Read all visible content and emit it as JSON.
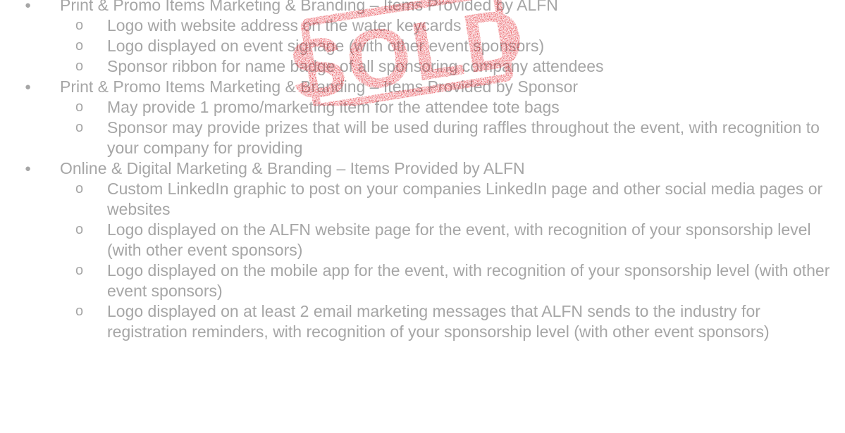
{
  "sections": [
    {
      "text": "Print & Promo Items Marketing & Branding – Items Provided by ALFN",
      "items": [
        "Logo with website address on the water keycards",
        "Logo displayed on event signage (with other event sponsors)",
        "Sponsor ribbon for name badge of all sponsoring company attendees"
      ]
    },
    {
      "text": "Print & Promo Items Marketing & Branding – Items Provided by Sponsor",
      "items": [
        "May provide 1 promo/marketing item for the attendee tote bags",
        "Sponsor may provide prizes that will be used during raffles throughout the event, with recognition to your company for providing"
      ]
    },
    {
      "text": "Online & Digital Marketing & Branding – Items Provided by ALFN",
      "items": [
        "Custom LinkedIn graphic to post on your companies LinkedIn page and other social media pages or websites",
        "Logo displayed on the ALFN website page for the event, with recognition of your sponsorship level (with other event sponsors)",
        "Logo displayed on the mobile app for the event, with recognition of your sponsorship level (with other event sponsors)",
        "Logo displayed on at least 2 email marketing messages that ALFN sends to the industry for registration reminders, with recognition of your sponsorship level (with other event sponsors)"
      ]
    }
  ],
  "stamp": {
    "text": "SOLD",
    "color": "#e0121b"
  },
  "colors": {
    "text": "#a6a6a6",
    "background": "#ffffff"
  }
}
